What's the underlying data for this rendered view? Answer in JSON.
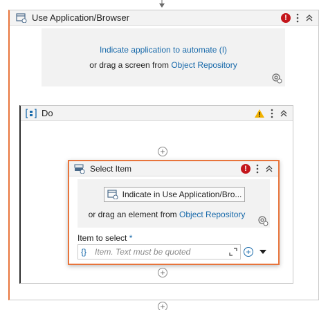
{
  "outer": {
    "title": "Use Application/Browser",
    "error_count": "!",
    "target": {
      "indicate_label": "Indicate application to automate (I)",
      "drag_prefix": "or drag a screen from ",
      "drag_link": "Object Repository"
    }
  },
  "do_block": {
    "title": "Do"
  },
  "select_item": {
    "title": "Select Item",
    "error_count": "!",
    "indicate_button": "Indicate in Use Application/Bro...",
    "drag_prefix": "or drag an element from ",
    "drag_link": "Object Repository",
    "field_label": "Item to select",
    "required_mark": "*",
    "field_brace": "{}",
    "field_placeholder": "Item. Text must be quoted"
  },
  "colors": {
    "accent_orange": "#e8743b",
    "link_blue": "#1769aa",
    "error_red": "#c4161c",
    "warning_yellow": "#f2b200"
  }
}
